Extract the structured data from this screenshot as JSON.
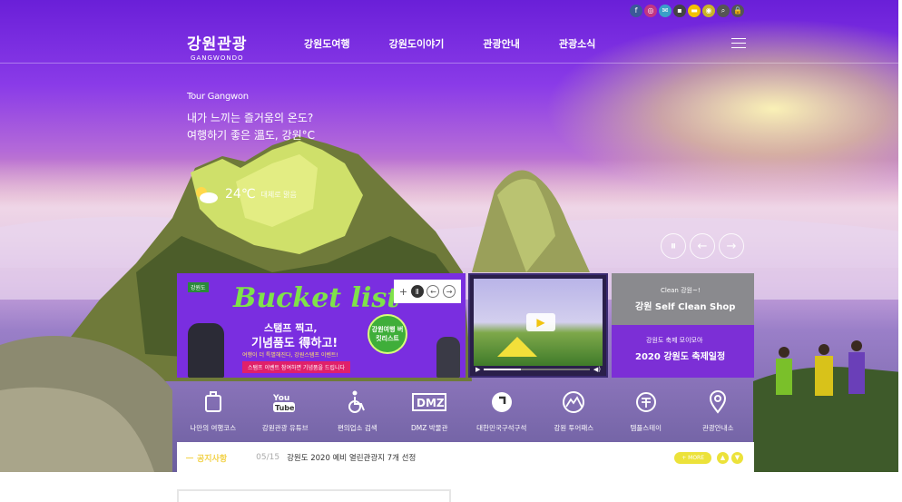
{
  "top_icons": [
    {
      "name": "facebook-icon",
      "glyph": "f",
      "color": "#3b5998"
    },
    {
      "name": "instagram-icon",
      "glyph": "◎",
      "color": "#c13584"
    },
    {
      "name": "chat-icon",
      "glyph": "✉",
      "color": "#3aa0c8"
    },
    {
      "name": "blog-icon",
      "glyph": "▪",
      "color": "#444444"
    },
    {
      "name": "kakao-story-icon",
      "glyph": "▬",
      "color": "#f2c200"
    },
    {
      "name": "camera-icon",
      "glyph": "◉",
      "color": "#c8b428"
    },
    {
      "name": "search-icon",
      "glyph": "⌕",
      "color": "#555555"
    },
    {
      "name": "lock-icon",
      "glyph": "🔒",
      "color": "#555555"
    }
  ],
  "header": {
    "logo_ko": "강원관광",
    "logo_en": "GANGWONDO",
    "nav": [
      "강원도여행",
      "강원도이야기",
      "관광안내",
      "관광소식"
    ]
  },
  "hero": {
    "eyebrow": "Tour Gangwon",
    "headline_1": "내가 느끼는 즐거움의 온도?",
    "headline_2": "여행하기 좋은 溫도, 강원°C",
    "weather_temp": "24℃",
    "weather_location": "대체로 맑음"
  },
  "slide_controls": {
    "pause": "⏸",
    "prev": "←",
    "next": "→"
  },
  "bucket_banner": {
    "badge": "강원도",
    "title": "Bucket list",
    "line1": "스탬프 찍고,",
    "line2": "기념품도 得하고!",
    "small": "여행이 더 특별해진다, 강원스탬프 이벤트!",
    "bar": "스탬프 이벤트 참여하면 기념품을 드립니다",
    "stamp": "강원여행 버킷리스트",
    "controls": {
      "add": "+",
      "pause": "Ⅱ",
      "prev": "←",
      "next": "→"
    }
  },
  "video": {
    "play_glyph": "▶",
    "ctrl": "▶",
    "vol": "◀)",
    "progress": 0.35
  },
  "clean_shop": {
    "sub": "Clean 강원~!",
    "title": "강원 Self Clean Shop"
  },
  "festival": {
    "sub": "강원도 축제 모이모아",
    "title": "2020 강원도 축제일정"
  },
  "quick_menu": [
    {
      "name": "my-trip-course",
      "label": "나만의 여행코스",
      "icon": "luggage-icon"
    },
    {
      "name": "youtube",
      "label": "강원관광 유튜브",
      "icon": "youtube-icon"
    },
    {
      "name": "accessibility",
      "label": "편의업소 검색",
      "icon": "wheelchair-icon"
    },
    {
      "name": "dmz-museum",
      "label": "DMZ 박물관",
      "icon": "dmz-icon"
    },
    {
      "name": "korean-map",
      "label": "대한민국구석구석",
      "icon": "corner-icon"
    },
    {
      "name": "tour-pass",
      "label": "강원 투어패스",
      "icon": "mountain-icon"
    },
    {
      "name": "temple-stay",
      "label": "템플스테이",
      "icon": "temple-icon"
    },
    {
      "name": "tour-info-center",
      "label": "관광안내소",
      "icon": "location-pin-icon"
    }
  ],
  "notice": {
    "label": "공지사항",
    "count": "05/15",
    "text": "강원도 2020 예비 열린관광지 7개 선정",
    "more": "+ MORE",
    "up": "▲",
    "down": "▼"
  }
}
